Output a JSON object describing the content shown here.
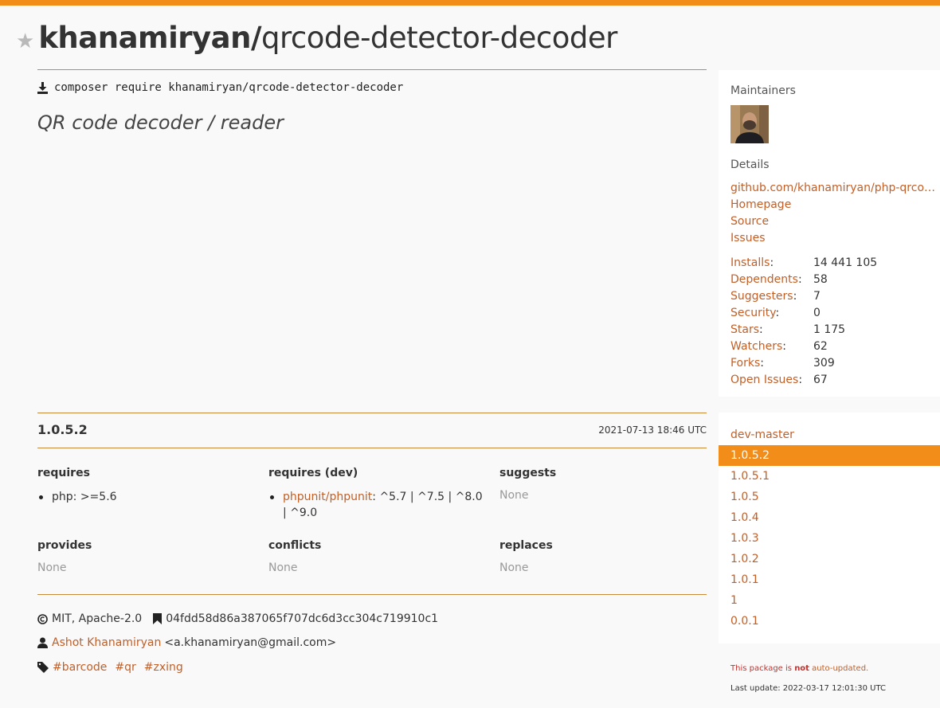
{
  "header": {
    "vendor": "khanamiryan/",
    "package": "qrcode-detector-decoder"
  },
  "install": {
    "command": "composer require khanamiryan/qrcode-detector-decoder"
  },
  "description": "QR code decoder / reader",
  "sidebar": {
    "maintainers_heading": "Maintainers",
    "details_heading": "Details",
    "links": [
      {
        "label": "github.com/khanamiryan/php-qrcode-detector-decoder"
      },
      {
        "label": "Homepage"
      },
      {
        "label": "Source"
      },
      {
        "label": "Issues"
      }
    ],
    "stats": [
      {
        "label": "Installs",
        "value": "14 441 105"
      },
      {
        "label": "Dependents",
        "value": "58"
      },
      {
        "label": "Suggesters",
        "value": "7"
      },
      {
        "label": "Security",
        "value": "0"
      },
      {
        "label": "Stars",
        "value": "1 175"
      },
      {
        "label": "Watchers",
        "value": "62"
      },
      {
        "label": "Forks",
        "value": "309"
      },
      {
        "label": "Open Issues",
        "value": "67"
      }
    ]
  },
  "version": {
    "name": "1.0.5.2",
    "date": "2021-07-13 18:46 UTC"
  },
  "deps": {
    "requires_title": "requires",
    "requires": [
      {
        "name": "php",
        "constraint": ">=5.6"
      }
    ],
    "requires_dev_title": "requires (dev)",
    "requires_dev": [
      {
        "name": "phpunit/phpunit",
        "constraint": "^5.7 | ^7.5 | ^8.0 | ^9.0"
      }
    ],
    "suggests_title": "suggests",
    "suggests_value": "None",
    "provides_title": "provides",
    "provides_value": "None",
    "conflicts_title": "conflicts",
    "conflicts_value": "None",
    "replaces_title": "replaces",
    "replaces_value": "None"
  },
  "meta": {
    "license": "MIT, Apache-2.0",
    "commit": "04fdd58d86a387065f707dc6d3cc304c719910c1",
    "author_name": "Ashot Khanamiryan",
    "author_email": "<a.khanamiryan@gmail.com>",
    "tags": [
      "#barcode",
      "#qr",
      "#zxing"
    ]
  },
  "versions": [
    "dev-master",
    "1.0.5.2",
    "1.0.5.1",
    "1.0.5",
    "1.0.4",
    "1.0.3",
    "1.0.2",
    "1.0.1",
    "1",
    "0.0.1"
  ],
  "active_version": "1.0.5.2",
  "notice": {
    "prefix": "This package is ",
    "emphasis": "not",
    "suffix": "auto-updated."
  },
  "last_update": "Last update: 2022-03-17 12:01:30 UTC",
  "colors": {
    "accent": "#f28d1a",
    "link": "#c25f27"
  }
}
